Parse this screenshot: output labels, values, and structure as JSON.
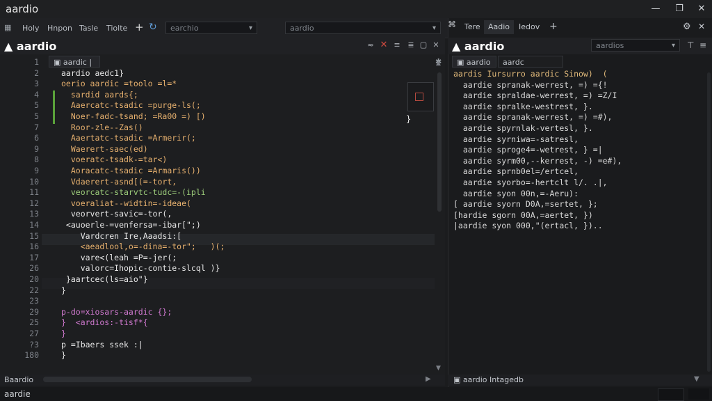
{
  "window": {
    "title": "aardio",
    "min": "—",
    "max": "❐",
    "close": "✕"
  },
  "menu": {
    "items": [
      "Holy",
      "Hnpon",
      "Tasle",
      "Tiolte"
    ],
    "combo1": "earchio",
    "combo2": "aardio"
  },
  "left": {
    "logo": "aardio",
    "tabs": [
      "aardic",
      "|"
    ],
    "lines": [
      {
        "n": "1",
        "t": ""
      },
      {
        "n": "2",
        "t": "aardio aedc1}"
      },
      {
        "n": "3",
        "t": "oerio aardic =toolo =l=*"
      },
      {
        "n": "4",
        "t": "  sardid aards{;"
      },
      {
        "n": "5",
        "t": "  Aaercatc-tsadic =purge-ls(;"
      },
      {
        "n": "5",
        "t": "  Noer-fadc-tsand; =Ra00 =) [)"
      },
      {
        "n": "7",
        "t": "  Roor-zle--Zas()"
      },
      {
        "n": "6",
        "t": "  Aaertatc-tsadic =Armerir(;"
      },
      {
        "n": "9",
        "t": "  Waerert-saec(ed)"
      },
      {
        "n": "8",
        "t": "  voeratc-tsadk-=tar<)"
      },
      {
        "n": "9",
        "t": "  Aoracatc-tsadic =Armaris())"
      },
      {
        "n": "10",
        "t": "  Vdaerert-asnd[(=-tort,"
      },
      {
        "n": "11",
        "t": "  veorcatc-starvtc-tudc=-(ipli"
      },
      {
        "n": "12",
        "t": "  voeraliat--widtin=-ideae("
      },
      {
        "n": "13",
        "t": "  veorvert-savic=-tor(,"
      },
      {
        "n": "14",
        "t": " <auoerle-=venfersa=-ibar[\";)"
      },
      {
        "n": "15",
        "t": "    Vardcren Ire,Aaadsi:["
      },
      {
        "n": "16",
        "t": "    <aeadlool,o=-dina=-tor\";   )(;"
      },
      {
        "n": "17",
        "t": "    vare<(leah =P=-jer(;"
      },
      {
        "n": "26",
        "t": "    valorc=Ihopic-contie-slcql )}"
      },
      {
        "n": "20",
        "t": " }aartcec(ls=aio\"}"
      },
      {
        "n": "22",
        "t": "}"
      },
      {
        "n": "23",
        "t": ""
      },
      {
        "n": "29",
        "t": "p-do=xiosars-aardic {};"
      },
      {
        "n": "25",
        "t": "}  <ardios:-tisf*{"
      },
      {
        "n": "27",
        "t": "}"
      },
      {
        "n": "?3",
        "t": "p =Ibaers ssek :|"
      },
      {
        "n": "180",
        "t": "}"
      }
    ],
    "status": "Baardio",
    "mini_right": "}"
  },
  "right": {
    "tabs": [
      "Tere",
      "Aadio",
      "Iedov"
    ],
    "logo": "aardio",
    "subtabs": [
      "aardio",
      "aardc"
    ],
    "combo": "aardios",
    "lines": [
      "aardis Iursurro aardic Sinow)  (",
      "  aardie spranak-werrest, =) ={!",
      "  aardie spraldae-werrest, =) =Z/I",
      "  aardie spralke-westrest, }.",
      "  aardie spranak-werrest, =) =#),",
      "  aardie spyrnlak-vertesl, }.",
      "  aardie syrniwa=-satresl,",
      "  aardie sproge4=-wetrest, } =|",
      "  aardie syrm00,--kerrest, -) =e#),",
      "  aardie sprnb0el=/ertcel,",
      "  aardie syorbo=-hertclt l/. .|,",
      "  aardie syon 00n,=-Aeru):",
      "[ aardie syorn D0A,=sertet, };",
      "[hardie sgorn 00A,=aertet, })",
      "|aardie syon 000,\"(ertacl, }).."
    ],
    "status": "aardio Intagedb"
  },
  "footer": {
    "text": "aardie"
  }
}
